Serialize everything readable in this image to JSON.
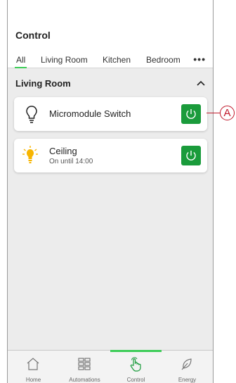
{
  "header": {
    "title": "Control"
  },
  "tabs": [
    {
      "label": "All",
      "active": true
    },
    {
      "label": "Living Room"
    },
    {
      "label": "Kitchen"
    },
    {
      "label": "Bedroom"
    }
  ],
  "more_icon": "more-horizontal-icon",
  "section": {
    "title": "Living Room",
    "chevron_icon": "chevron-up-icon"
  },
  "devices": [
    {
      "name": "Micromodule Switch",
      "icon": "bulb-outline-icon",
      "power_icon": "power-icon"
    },
    {
      "name": "Ceiling",
      "status": "On until 14:00",
      "icon": "bulb-lit-icon",
      "power_icon": "power-icon"
    }
  ],
  "nav": [
    {
      "label": "Home",
      "icon": "home-icon"
    },
    {
      "label": "Automations",
      "icon": "grid-icon"
    },
    {
      "label": "Control",
      "icon": "hand-touch-icon",
      "active": true
    },
    {
      "label": "Energy",
      "icon": "leaf-icon"
    }
  ],
  "callout": {
    "label": "A"
  },
  "colors": {
    "accent": "#3dcd58",
    "power_button": "#1a9b3b",
    "callout": "#c0182a",
    "bulb_lit": "#f7b500"
  }
}
